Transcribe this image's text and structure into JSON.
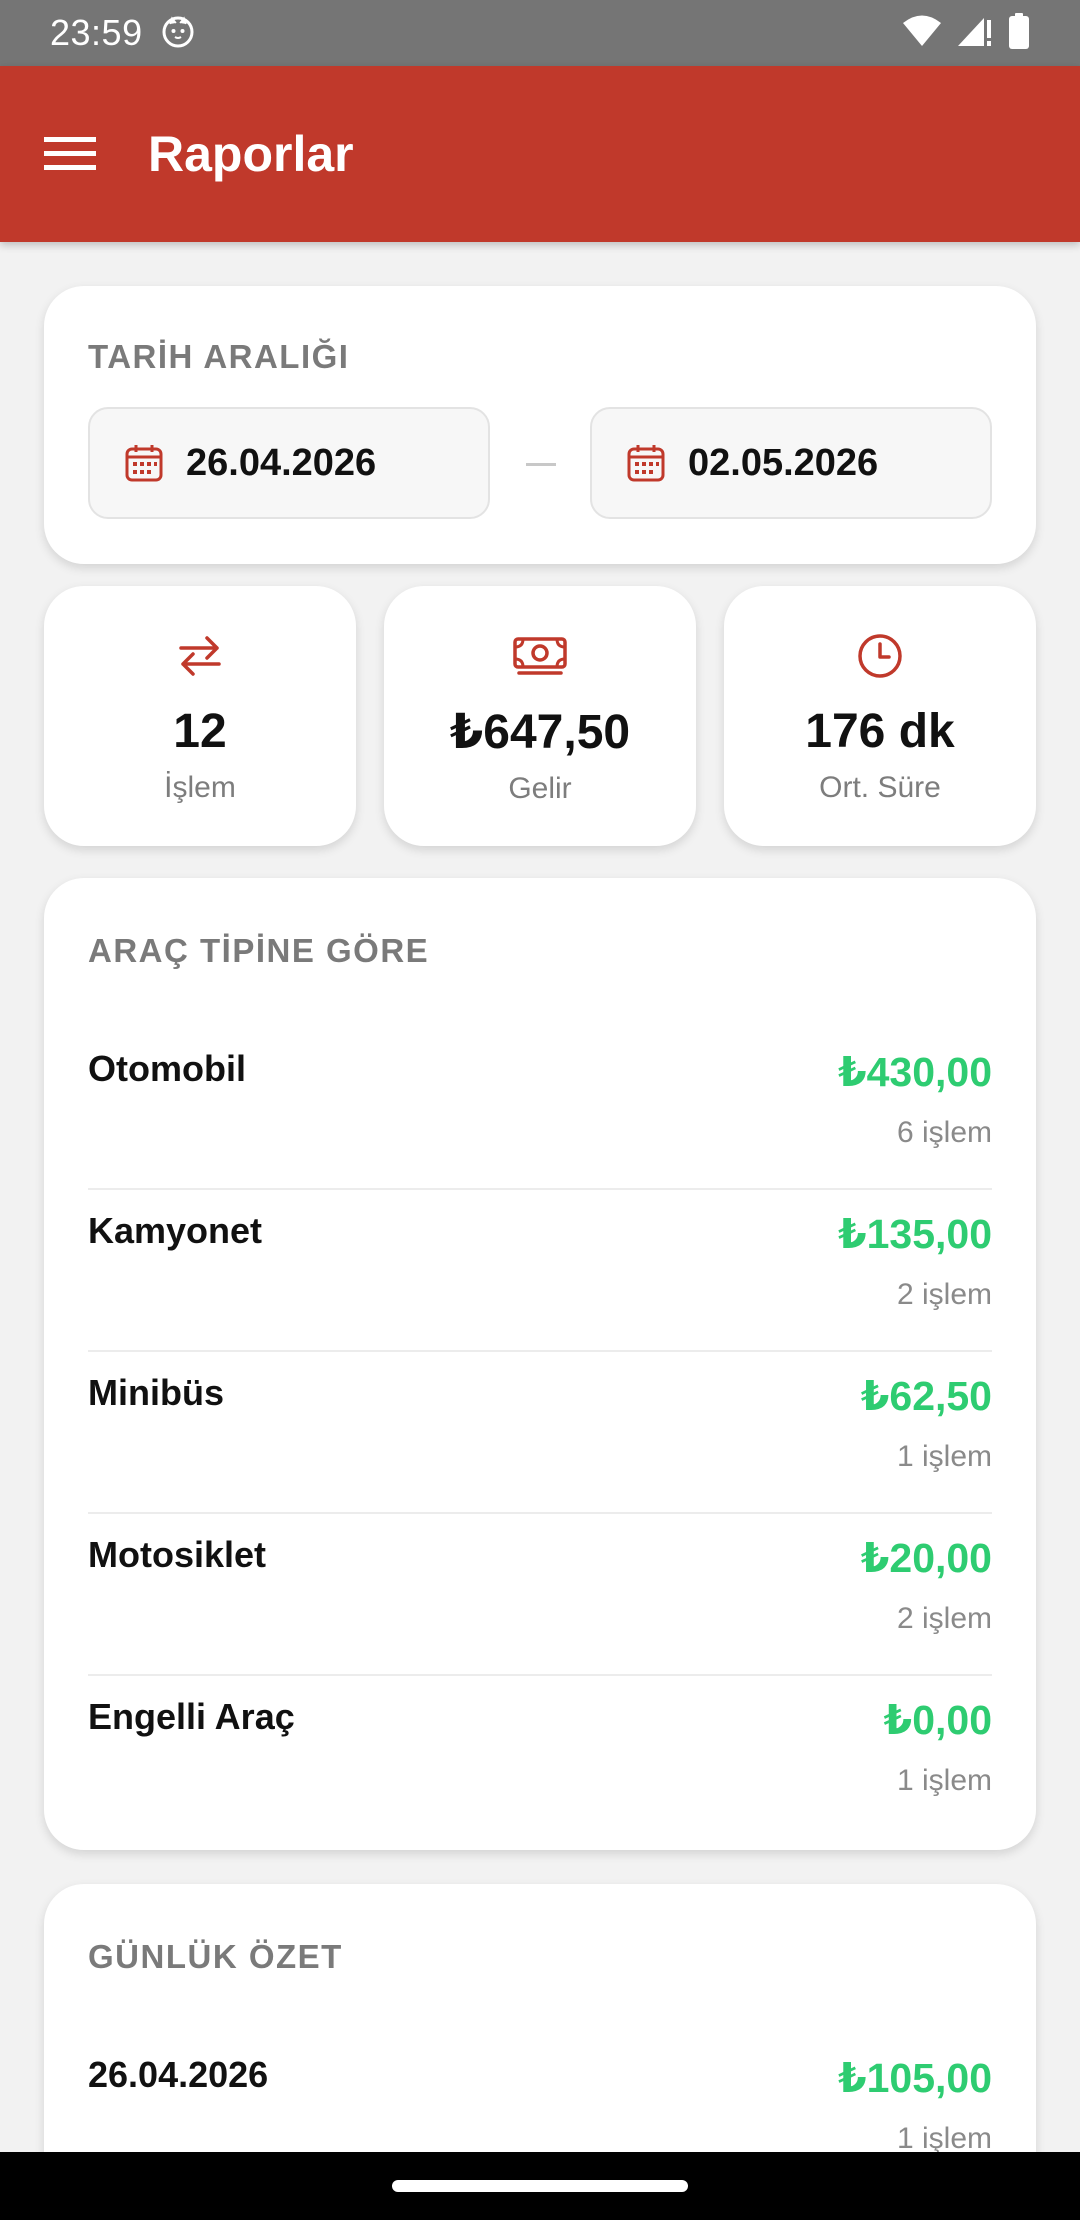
{
  "status_bar": {
    "time": "23:59"
  },
  "app_bar": {
    "title": "Raporlar"
  },
  "date_range": {
    "title": "TARİH ARALIĞI",
    "start": "26.04.2026",
    "end": "02.05.2026"
  },
  "stats": [
    {
      "value": "12",
      "label": "İşlem",
      "icon": "swap-arrows-icon"
    },
    {
      "value": "₺647,50",
      "label": "Gelir",
      "icon": "money-icon"
    },
    {
      "value": "176 dk",
      "label": "Ort. Süre",
      "icon": "clock-icon"
    }
  ],
  "vehicle_types": {
    "title": "ARAÇ TİPİNE GÖRE",
    "items": [
      {
        "name": "Otomobil",
        "amount": "₺430,00",
        "count": "6 işlem"
      },
      {
        "name": "Kamyonet",
        "amount": "₺135,00",
        "count": "2 işlem"
      },
      {
        "name": "Minibüs",
        "amount": "₺62,50",
        "count": "1 işlem"
      },
      {
        "name": "Motosiklet",
        "amount": "₺20,00",
        "count": "2 işlem"
      },
      {
        "name": "Engelli Araç",
        "amount": "₺0,00",
        "count": "1 işlem"
      }
    ]
  },
  "daily_summary": {
    "title": "GÜNLÜK ÖZET",
    "items": [
      {
        "date": "26.04.2026",
        "amount": "₺105,00",
        "count": "1 işlem"
      }
    ]
  },
  "colors": {
    "primary": "#c0392b",
    "positive": "#2ecc71",
    "statusbar": "#757575"
  }
}
